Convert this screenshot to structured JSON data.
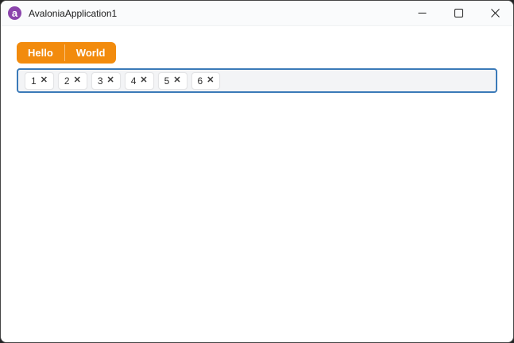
{
  "window": {
    "title": "AvaloniaApplication1",
    "logo_glyph": "a",
    "controls": {
      "minimize_icon": "minimize",
      "maximize_icon": "maximize",
      "close_icon": "close"
    }
  },
  "tabs": {
    "items": [
      {
        "label": "Hello"
      },
      {
        "label": "World"
      }
    ]
  },
  "chips": {
    "remove_icon": "✕",
    "items": [
      {
        "label": "1"
      },
      {
        "label": "2"
      },
      {
        "label": "3"
      },
      {
        "label": "4"
      },
      {
        "label": "5"
      },
      {
        "label": "6"
      }
    ]
  },
  "colors": {
    "accent_orange": "#F28B0D",
    "focus_border_blue": "#3B7AB8",
    "logo_purple": "#8B44AC",
    "titlebar_bg": "#FAFBFC",
    "chipbox_bg": "#F3F4F6"
  }
}
